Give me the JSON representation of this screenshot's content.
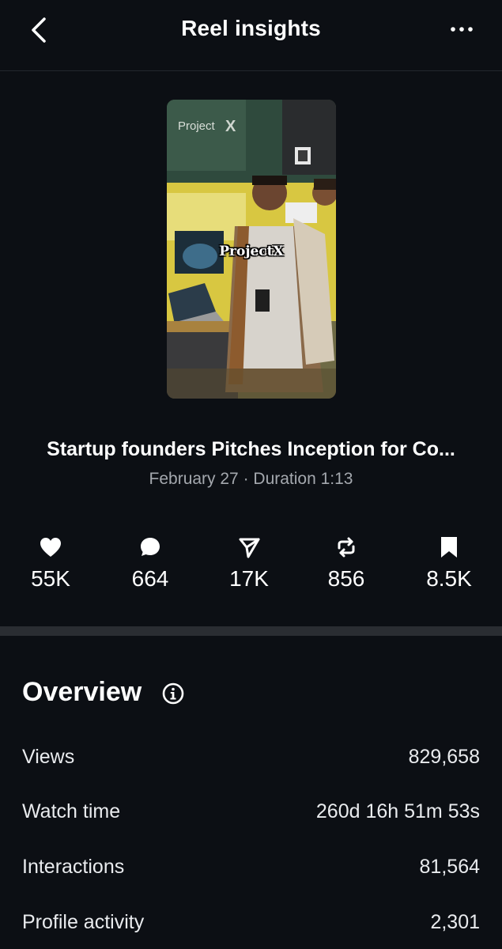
{
  "header": {
    "title": "Reel insights"
  },
  "reel": {
    "overlay_caption": "ProjectX",
    "title": "Startup founders Pitches Inception for Co...",
    "meta": "February 27 · Duration 1:13"
  },
  "stats": [
    {
      "icon": "heart-icon",
      "value": "55K"
    },
    {
      "icon": "comment-icon",
      "value": "664"
    },
    {
      "icon": "share-icon",
      "value": "17K"
    },
    {
      "icon": "repost-icon",
      "value": "856"
    },
    {
      "icon": "bookmark-icon",
      "value": "8.5K"
    }
  ],
  "overview": {
    "title": "Overview",
    "rows": [
      {
        "label": "Views",
        "value": "829,658"
      },
      {
        "label": "Watch time",
        "value": "260d 16h 51m 53s"
      },
      {
        "label": "Interactions",
        "value": "81,564"
      },
      {
        "label": "Profile activity",
        "value": "2,301"
      }
    ]
  },
  "colors": {
    "background": "#0c0f14",
    "divider": "#2a2d32",
    "secondary_text": "#a4a8ae"
  }
}
